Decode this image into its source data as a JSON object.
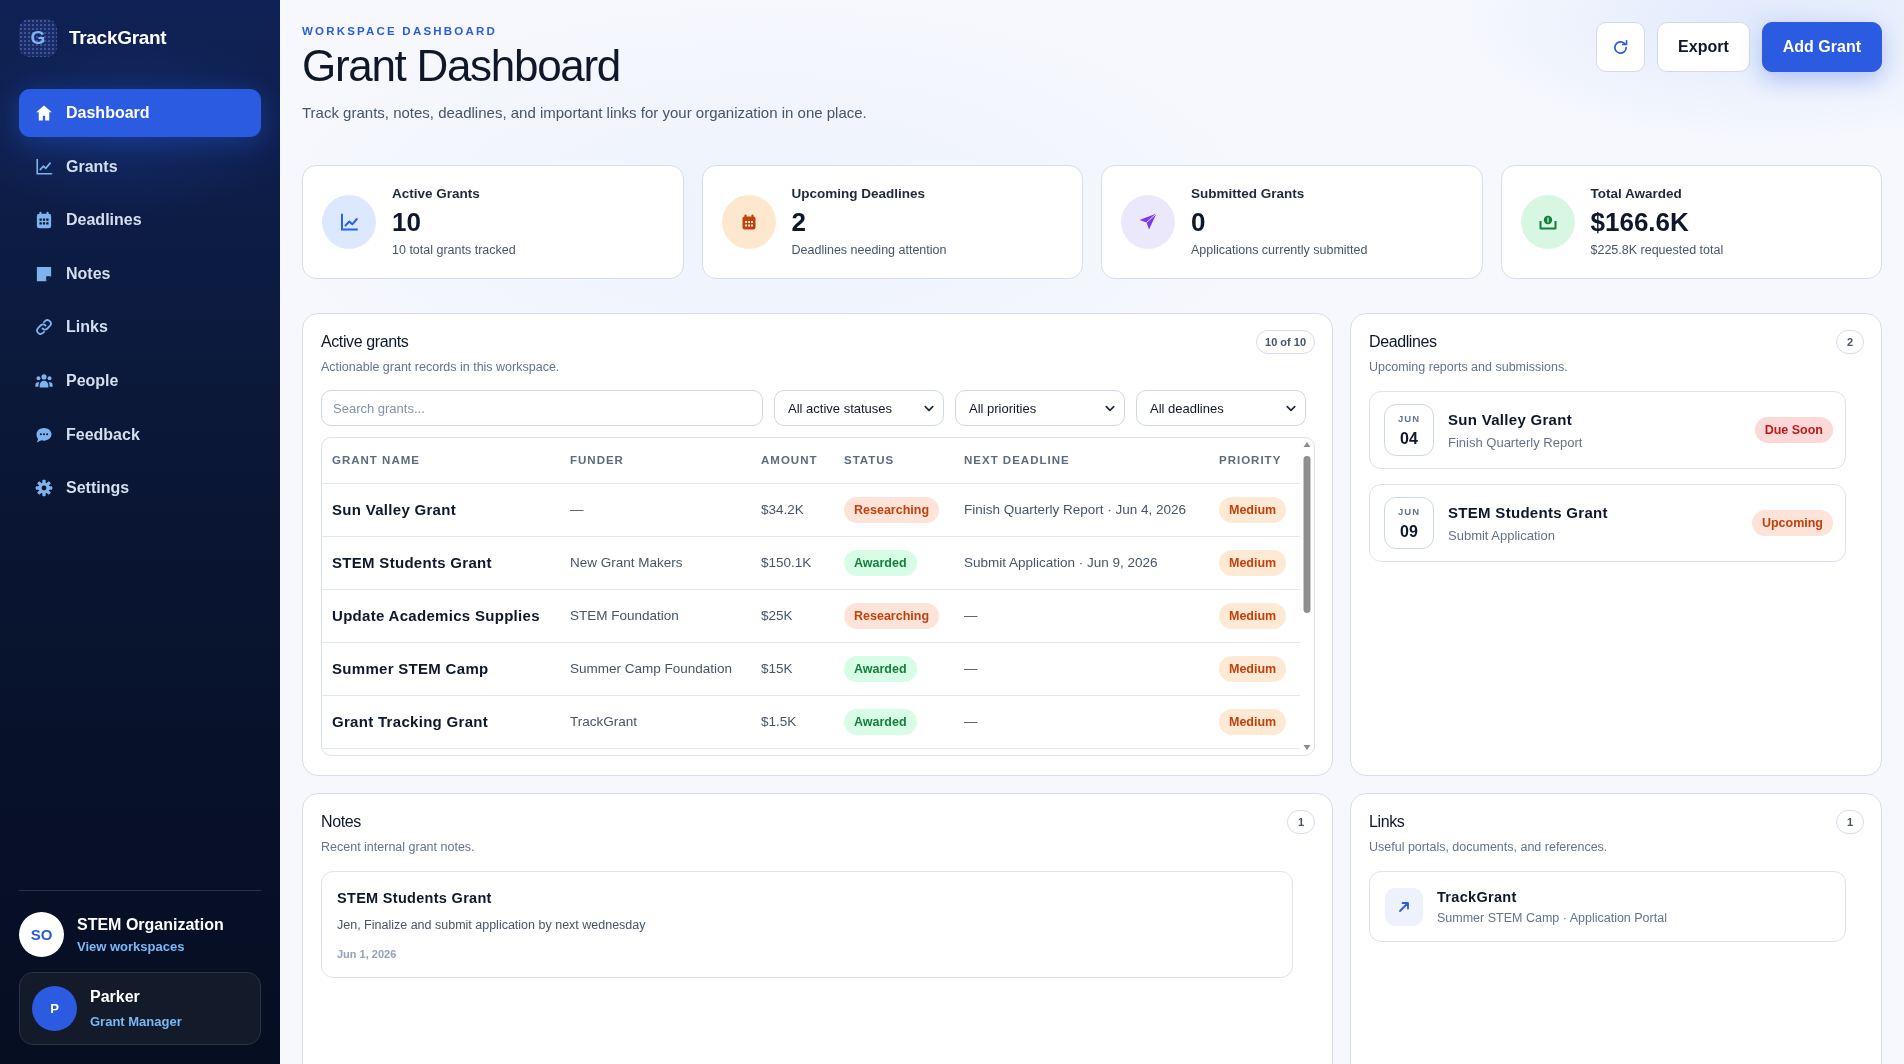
{
  "sidebar": {
    "brand": {
      "logo_letter": "G",
      "name": "TrackGrant"
    },
    "nav_items": [
      {
        "label": "Dashboard",
        "selected": true
      },
      {
        "label": "Grants",
        "selected": false
      },
      {
        "label": "Deadlines",
        "selected": false
      },
      {
        "label": "Notes",
        "selected": false
      },
      {
        "label": "Links",
        "selected": false
      },
      {
        "label": "People",
        "selected": false
      },
      {
        "label": "Feedback",
        "selected": false
      },
      {
        "label": "Settings",
        "selected": false
      }
    ],
    "workspace": {
      "initials": "SO",
      "name": "STEM Organization",
      "link": "View workspaces"
    },
    "user": {
      "initial": "P",
      "name": "Parker",
      "role": "Grant Manager"
    }
  },
  "header": {
    "eyebrow": "WORKSPACE DASHBOARD",
    "title": "Grant Dashboard",
    "subtitle": "Track grants, notes, deadlines, and important links for your organization in one place.",
    "actions": [
      {
        "kind": "icon"
      },
      {
        "kind": "secondary",
        "label": "Export"
      },
      {
        "kind": "primary",
        "label": "Add Grant"
      }
    ]
  },
  "stats": [
    {
      "label": "Active Grants",
      "value": "10",
      "note": "10 total grants tracked"
    },
    {
      "label": "Upcoming Deadlines",
      "value": "2",
      "note": "Deadlines needing attention"
    },
    {
      "label": "Submitted Grants",
      "value": "0",
      "note": "Applications currently submitted"
    },
    {
      "label": "Total Awarded",
      "value": "$166.6K",
      "note": "$225.8K requested total"
    }
  ],
  "active_grants": {
    "title": "Active grants",
    "subtitle": "Actionable grant records in this workspace.",
    "count": "10 of 10",
    "search": {
      "placeholder": "Search grants..."
    },
    "filters": [
      "All active statuses",
      "All priorities",
      "All deadlines"
    ],
    "table": {
      "columns": [
        "GRANT NAME",
        "FUNDER",
        "AMOUNT",
        "STATUS",
        "NEXT DEADLINE",
        "PRIORITY"
      ],
      "rows": [
        {
          "grant_name": "Sun Valley Grant",
          "funder": "—",
          "amount": "$34.2K",
          "status": {
            "label": "Researching",
            "color": "#c2410c"
          },
          "next_deadline": "Finish Quarterly Report · Jun 4, 2026",
          "priority": "Medium"
        },
        {
          "grant_name": "STEM Students Grant",
          "funder": "New Grant Makers",
          "amount": "$150.1K",
          "status": {
            "label": "Awarded",
            "color": "#15803d"
          },
          "next_deadline": "Submit Application · Jun 9, 2026",
          "priority": "Medium"
        },
        {
          "grant_name": "Update Academics Supplies",
          "funder": "STEM Foundation",
          "amount": "$25K",
          "status": {
            "label": "Researching",
            "color": "#c2410c"
          },
          "next_deadline": "—",
          "priority": "Medium"
        },
        {
          "grant_name": "Summer STEM Camp",
          "funder": "Summer Camp Foundation",
          "amount": "$15K",
          "status": {
            "label": "Awarded",
            "color": "#15803d"
          },
          "next_deadline": "—",
          "priority": "Medium"
        },
        {
          "grant_name": "Grant Tracking Grant",
          "funder": "TrackGrant",
          "amount": "$1.5K",
          "status": {
            "label": "Awarded",
            "color": "#15803d"
          },
          "next_deadline": "—",
          "priority": "Medium"
        }
      ]
    }
  },
  "deadlines": {
    "title": "Deadlines",
    "subtitle": "Upcoming reports and submissions.",
    "count": "2",
    "items": [
      {
        "month": "JUN",
        "day": "04",
        "grant": "Sun Valley Grant",
        "task": "Finish Quarterly Report",
        "badge": {
          "label": "Due Soon",
          "color": "#b91c1c"
        }
      },
      {
        "month": "JUN",
        "day": "09",
        "grant": "STEM Students Grant",
        "task": "Submit Application",
        "badge": {
          "label": "Upcoming",
          "color": "#c2410c"
        }
      }
    ]
  },
  "notes": {
    "title": "Notes",
    "subtitle": "Recent internal grant notes.",
    "count": "1",
    "items": [
      {
        "title": "STEM Students Grant",
        "body": "Jen, Finalize and submit application by next wednesday",
        "date": "Jun 1, 2026"
      }
    ]
  },
  "links": {
    "title": "Links",
    "subtitle": "Useful portals, documents, and references.",
    "count": "1",
    "items": [
      {
        "title": "TrackGrant",
        "detail": "Summer STEM Camp · Application Portal"
      }
    ]
  }
}
